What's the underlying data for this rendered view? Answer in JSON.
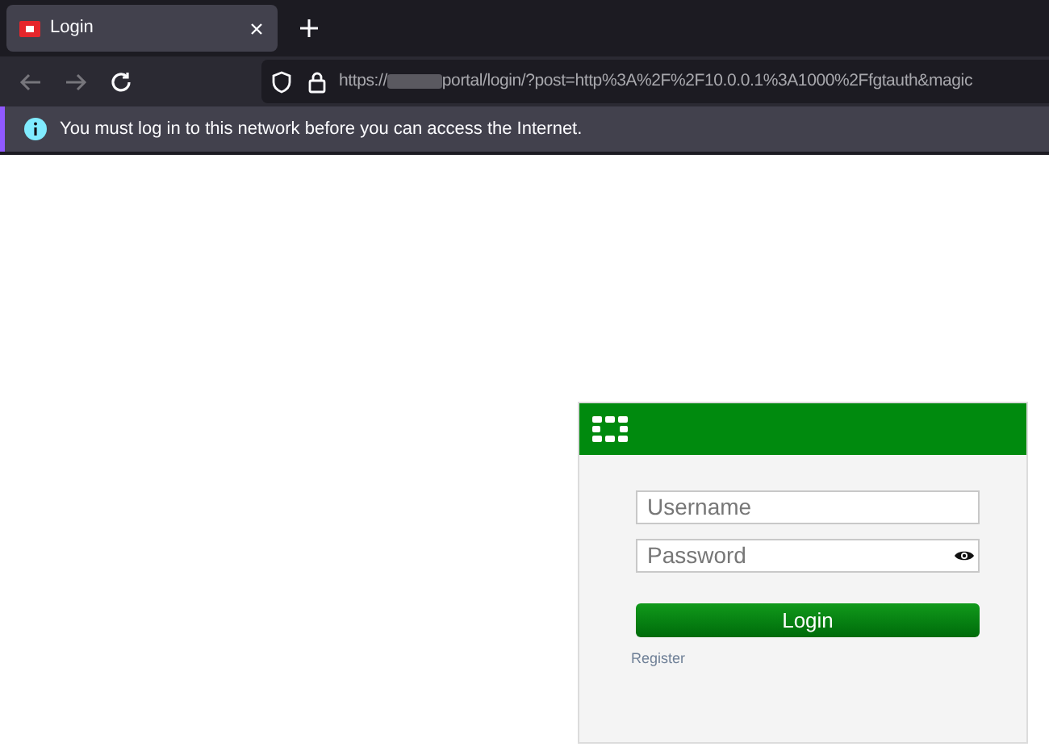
{
  "tabs": [
    {
      "label": "Login",
      "selected": true
    }
  ],
  "address_bar": {
    "url_start": "https://",
    "url_end": "portal/login/?post=http%3A%2F%2F10.0.0.1%3A1000%2Ffgtauth&magic"
  },
  "notification": {
    "message": "You must log in to this network before you can access the Internet."
  },
  "login_form": {
    "username": {
      "placeholder": "Username"
    },
    "password": {
      "placeholder": "Password"
    },
    "submit": "Login",
    "register_link": "Register"
  }
}
